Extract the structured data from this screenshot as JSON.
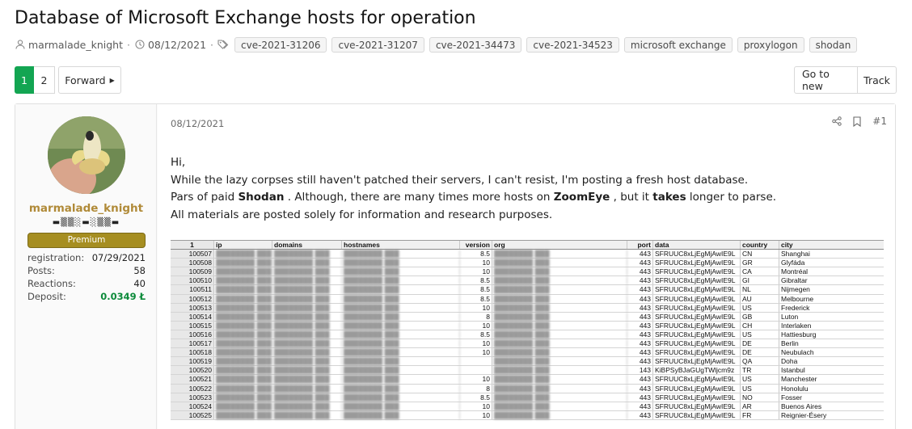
{
  "thread": {
    "title": "Database of Microsoft Exchange hosts for operation",
    "author": "marmalade_knight",
    "date": "08/12/2021",
    "tags": [
      "cve-2021-31206",
      "cve-2021-31207",
      "cve-2021-34473",
      "cve-2021-34523",
      "microsoft exchange",
      "proxylogon",
      "shodan"
    ]
  },
  "pagination": {
    "pages": [
      "1",
      "2"
    ],
    "forward_label": "Forward",
    "go_to_new_label": "Go to new",
    "track_label": "Track"
  },
  "user": {
    "name": "marmalade_knight",
    "title": "▬▒▒░▬░▒▒▬",
    "badge": "Premium",
    "stats": [
      {
        "label": "registration:",
        "value": "07/29/2021"
      },
      {
        "label": "Posts:",
        "value": "58"
      },
      {
        "label": "Reactions:",
        "value": "40"
      },
      {
        "label": "Deposit:",
        "value": "0.0349 Ł"
      }
    ]
  },
  "post": {
    "date": "08/12/2021",
    "number": "#1",
    "greeting": "Hi,",
    "line1": "While the lazy corpses still haven't patched their servers, I can't resist, I'm posting a fresh host database.",
    "line2_pre": "Pars of paid ",
    "line2_b1": "Shodan",
    "line2_mid": " . Although, there are many times more hosts on ",
    "line2_b2": "ZoomEye",
    "line2_mid2": " , but it ",
    "line2_b3": "takes",
    "line2_post": " longer to parse.",
    "line3": "All materials are posted solely for information and research purposes."
  },
  "spreadsheet": {
    "headers": [
      "1",
      "ip",
      "domains",
      "hostnames",
      "version",
      "org",
      "port",
      "data",
      "country",
      "city"
    ],
    "rows": [
      {
        "id": "100507",
        "version": "8.5",
        "port": "443",
        "data": "SFRUUC8xLjEgMjAwIE9L",
        "country": "CN",
        "city": "Shanghai"
      },
      {
        "id": "100508",
        "version": "10",
        "port": "443",
        "data": "SFRUUC8xLjEgMjAwIE9L",
        "country": "GR",
        "city": "Glyfáda"
      },
      {
        "id": "100509",
        "version": "10",
        "port": "443",
        "data": "SFRUUC8xLjEgMjAwIE9L",
        "country": "CA",
        "city": "Montréal"
      },
      {
        "id": "100510",
        "version": "8.5",
        "port": "443",
        "data": "SFRUUC8xLjEgMjAwIE9L",
        "country": "GI",
        "city": "Gibraltar"
      },
      {
        "id": "100511",
        "version": "8.5",
        "port": "443",
        "data": "SFRUUC8xLjEgMjAwIE9L",
        "country": "NL",
        "city": "Nijmegen"
      },
      {
        "id": "100512",
        "version": "8.5",
        "port": "443",
        "data": "SFRUUC8xLjEgMjAwIE9L",
        "country": "AU",
        "city": "Melbourne"
      },
      {
        "id": "100513",
        "version": "10",
        "port": "443",
        "data": "SFRUUC8xLjEgMjAwIE9L",
        "country": "US",
        "city": "Frederick"
      },
      {
        "id": "100514",
        "version": "8",
        "port": "443",
        "data": "SFRUUC8xLjEgMjAwIE9L",
        "country": "GB",
        "city": "Luton"
      },
      {
        "id": "100515",
        "version": "10",
        "port": "443",
        "data": "SFRUUC8xLjEgMjAwIE9L",
        "country": "CH",
        "city": "Interlaken"
      },
      {
        "id": "100516",
        "version": "8.5",
        "port": "443",
        "data": "SFRUUC8xLjEgMjAwIE9L",
        "country": "US",
        "city": "Hattiesburg"
      },
      {
        "id": "100517",
        "version": "10",
        "port": "443",
        "data": "SFRUUC8xLjEgMjAwIE9L",
        "country": "DE",
        "city": "Berlin"
      },
      {
        "id": "100518",
        "version": "10",
        "port": "443",
        "data": "SFRUUC8xLjEgMjAwIE9L",
        "country": "DE",
        "city": "Neubulach"
      },
      {
        "id": "100519",
        "version": "",
        "port": "443",
        "data": "SFRUUC8xLjEgMjAwIE9L",
        "country": "QA",
        "city": "Doha"
      },
      {
        "id": "100520",
        "version": "",
        "port": "143",
        "data": "KiBPSyBJaGUgTWljcm9z",
        "country": "TR",
        "city": "Istanbul"
      },
      {
        "id": "100521",
        "version": "10",
        "port": "443",
        "data": "SFRUUC8xLjEgMjAwIE9L",
        "country": "US",
        "city": "Manchester"
      },
      {
        "id": "100522",
        "version": "8",
        "port": "443",
        "data": "SFRUUC8xLjEgMjAwIE9L",
        "country": "US",
        "city": "Honolulu"
      },
      {
        "id": "100523",
        "version": "8.5",
        "port": "443",
        "data": "SFRUUC8xLjEgMjAwIE9L",
        "country": "NO",
        "city": "Fosser"
      },
      {
        "id": "100524",
        "version": "10",
        "port": "443",
        "data": "SFRUUC8xLjEgMjAwIE9L",
        "country": "AR",
        "city": "Buenos Aires"
      },
      {
        "id": "100525",
        "version": "10",
        "port": "443",
        "data": "SFRUUC8xLjEgMjAwIE9L",
        "country": "FR",
        "city": "Reignier-Ésery"
      }
    ]
  }
}
